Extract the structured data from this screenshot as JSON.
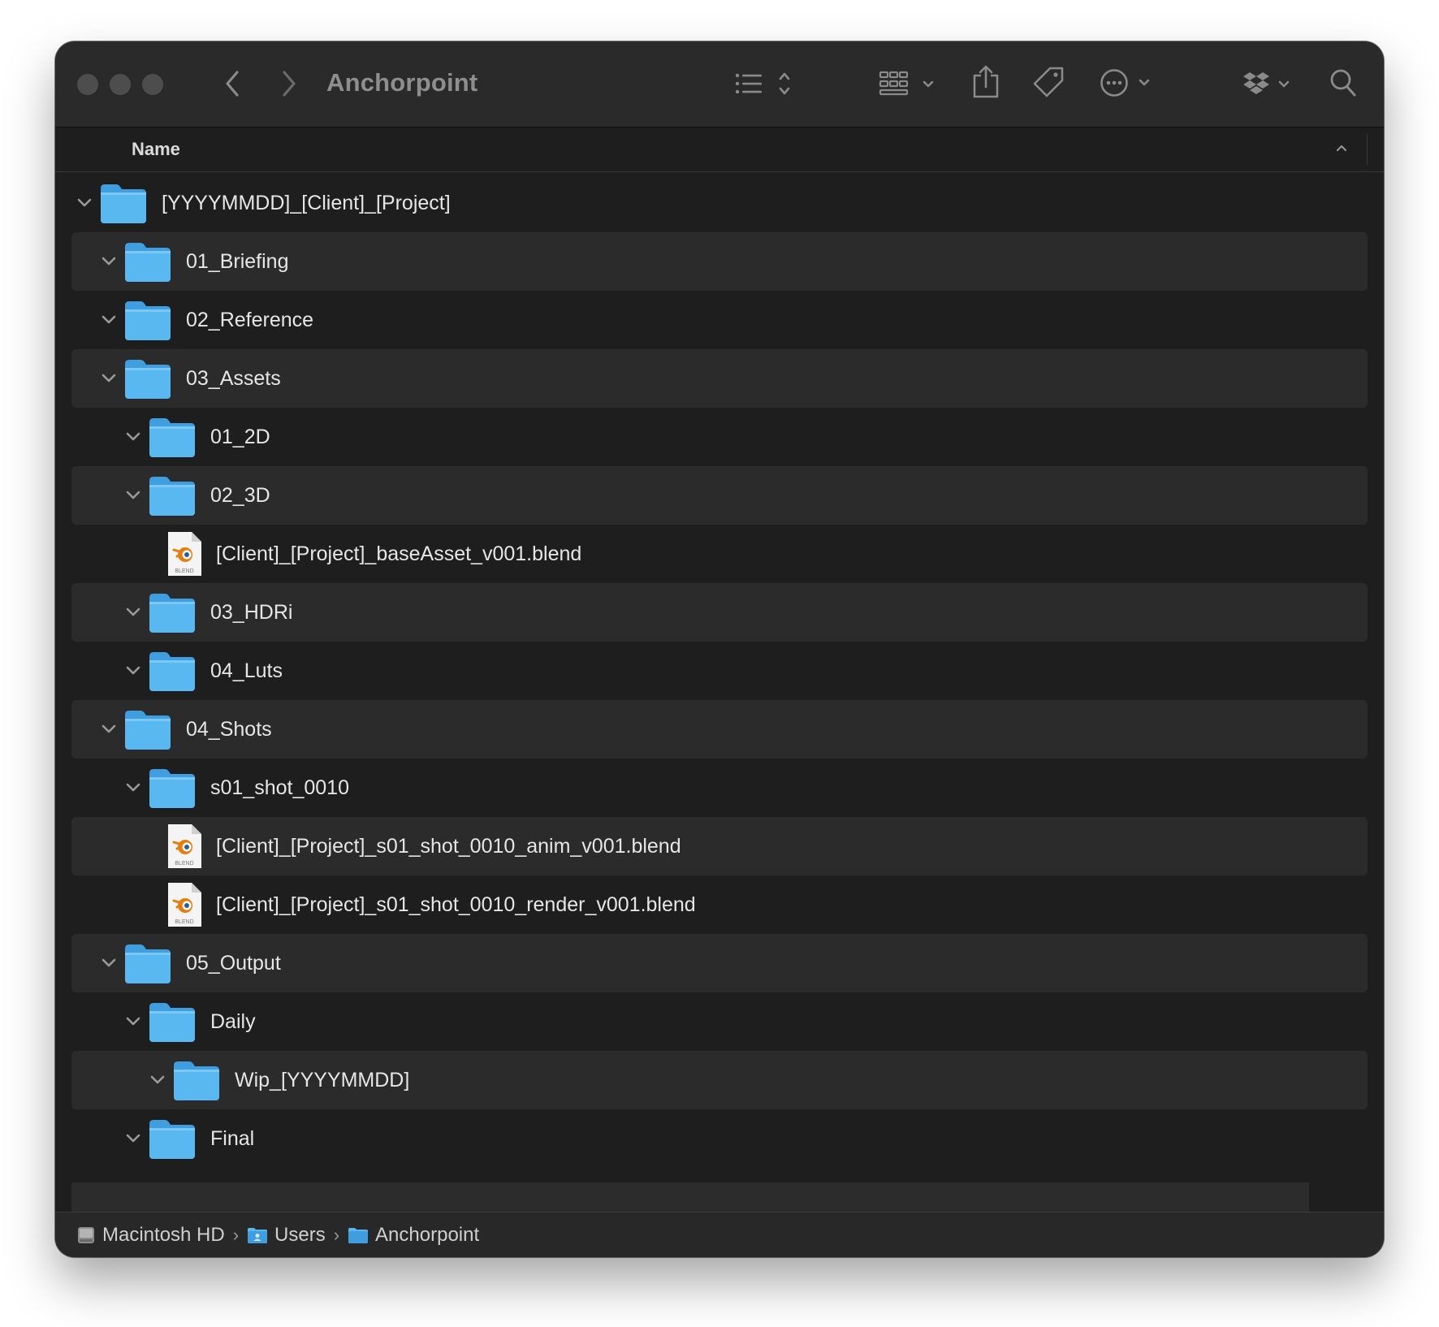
{
  "window": {
    "title": "Anchorpoint"
  },
  "header": {
    "name_column": "Name"
  },
  "tree": [
    {
      "label": "[YYYYMMDD]_[Client]_[Project]",
      "type": "folder",
      "depth": 0
    },
    {
      "label": "01_Briefing",
      "type": "folder",
      "depth": 1
    },
    {
      "label": "02_Reference",
      "type": "folder",
      "depth": 1
    },
    {
      "label": "03_Assets",
      "type": "folder",
      "depth": 1
    },
    {
      "label": "01_2D",
      "type": "folder",
      "depth": 2
    },
    {
      "label": "02_3D",
      "type": "folder",
      "depth": 2
    },
    {
      "label": "[Client]_[Project]_baseAsset_v001.blend",
      "type": "blend",
      "depth": 3
    },
    {
      "label": "03_HDRi",
      "type": "folder",
      "depth": 2
    },
    {
      "label": "04_Luts",
      "type": "folder",
      "depth": 2
    },
    {
      "label": "04_Shots",
      "type": "folder",
      "depth": 1
    },
    {
      "label": "s01_shot_0010",
      "type": "folder",
      "depth": 2
    },
    {
      "label": "[Client]_[Project]_s01_shot_0010_anim_v001.blend",
      "type": "blend",
      "depth": 3
    },
    {
      "label": "[Client]_[Project]_s01_shot_0010_render_v001.blend",
      "type": "blend",
      "depth": 3
    },
    {
      "label": "05_Output",
      "type": "folder",
      "depth": 1
    },
    {
      "label": "Daily",
      "type": "folder",
      "depth": 2
    },
    {
      "label": "Wip_[YYYYMMDD]",
      "type": "folder",
      "depth": 3
    },
    {
      "label": "Final",
      "type": "folder",
      "depth": 2
    }
  ],
  "blend_icon_text": "BLEND",
  "pathbar": {
    "items": [
      {
        "label": "Macintosh HD",
        "icon": "hard-drive-icon"
      },
      {
        "label": "Users",
        "icon": "users-folder-icon"
      },
      {
        "label": "Anchorpoint",
        "icon": "folder-icon"
      }
    ],
    "separator": "›"
  },
  "colors": {
    "folder": "#5ab8f0",
    "folder_dark": "#3f9ee0",
    "blend_orange": "#e87d0d",
    "window_bg": "#1e1e1e",
    "stripe": "#2b2b2b"
  },
  "toolbar_icons": [
    "close-button",
    "minimize-button",
    "zoom-button",
    "back-icon",
    "forward-icon",
    "list-view-icon",
    "group-icon",
    "share-icon",
    "tag-icon",
    "more-icon",
    "dropbox-icon",
    "search-icon"
  ]
}
